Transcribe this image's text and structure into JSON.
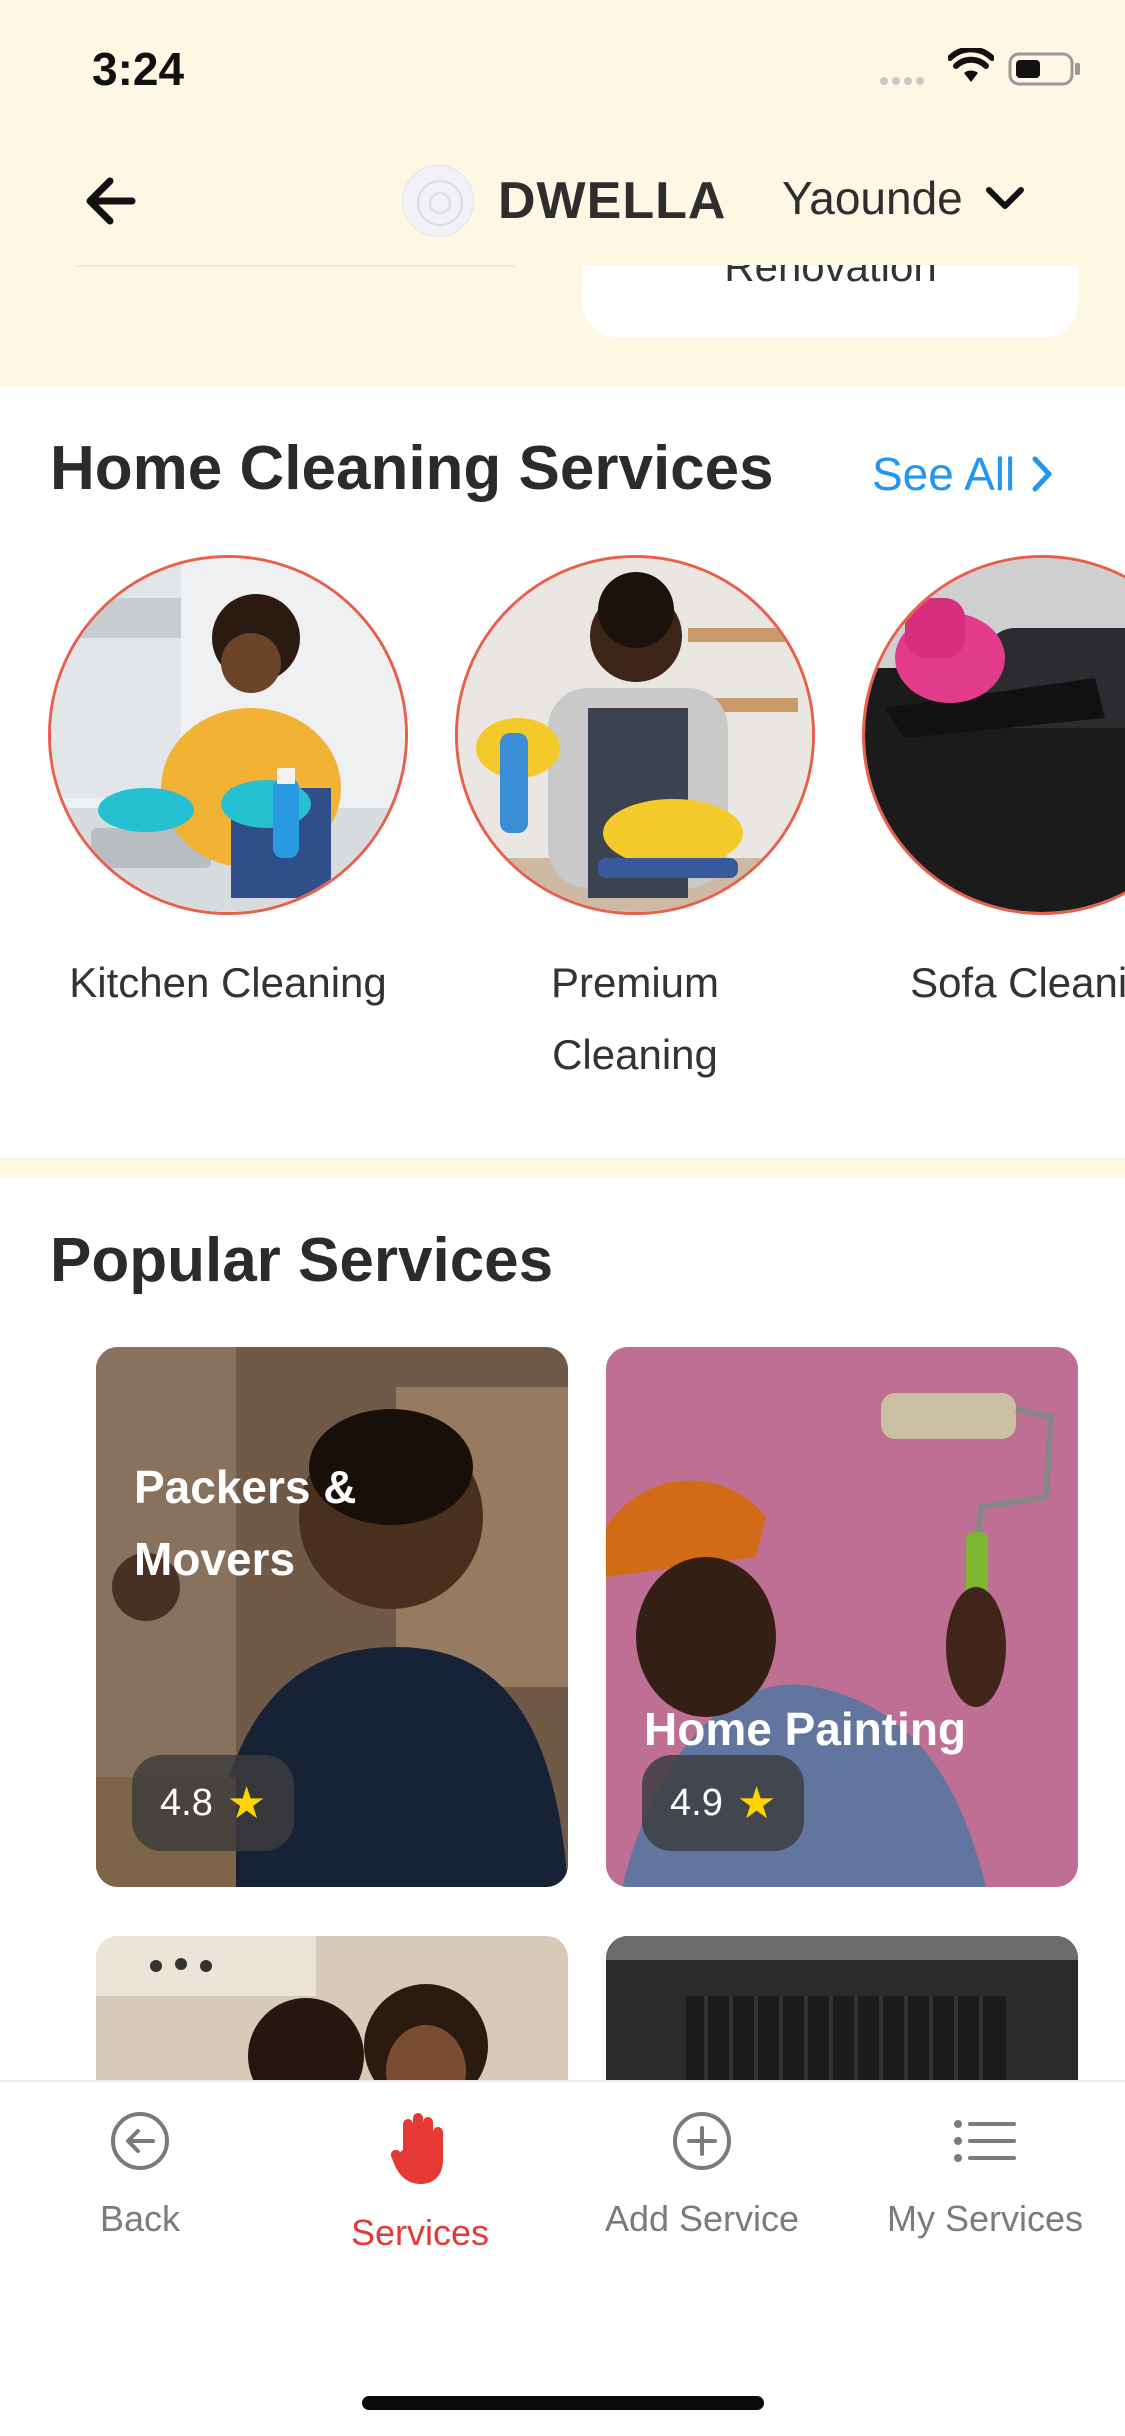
{
  "status_bar": {
    "time": "3:24"
  },
  "header": {
    "brand_name": "DWELLA",
    "city": "Yaounde"
  },
  "scrolled_row": {
    "partial_card_label": "Renovation"
  },
  "home_cleaning": {
    "title": "Home Cleaning Services",
    "see_all": "See All",
    "items": [
      {
        "label": "Kitchen Cleaning"
      },
      {
        "label": "Premium Cleaning"
      },
      {
        "label": "Sofa Cleaning"
      }
    ]
  },
  "popular": {
    "title": "Popular Services",
    "cards": [
      {
        "title": "Packers & Movers",
        "rating": "4.8"
      },
      {
        "title": "Home Painting",
        "rating": "4.9"
      }
    ]
  },
  "tab_bar": {
    "active": "Services",
    "tabs": [
      {
        "label": "Back",
        "icon": "back-circle-icon"
      },
      {
        "label": "Services",
        "icon": "hand-icon"
      },
      {
        "label": "Add Service",
        "icon": "add-circle-icon"
      },
      {
        "label": "My Services",
        "icon": "list-icon"
      }
    ]
  },
  "colors": {
    "accent_red": "#E53935",
    "link_blue": "#2196F3",
    "ring": "#E8604C",
    "star": "#FFD400",
    "page_bg": "#FDF7E4"
  }
}
